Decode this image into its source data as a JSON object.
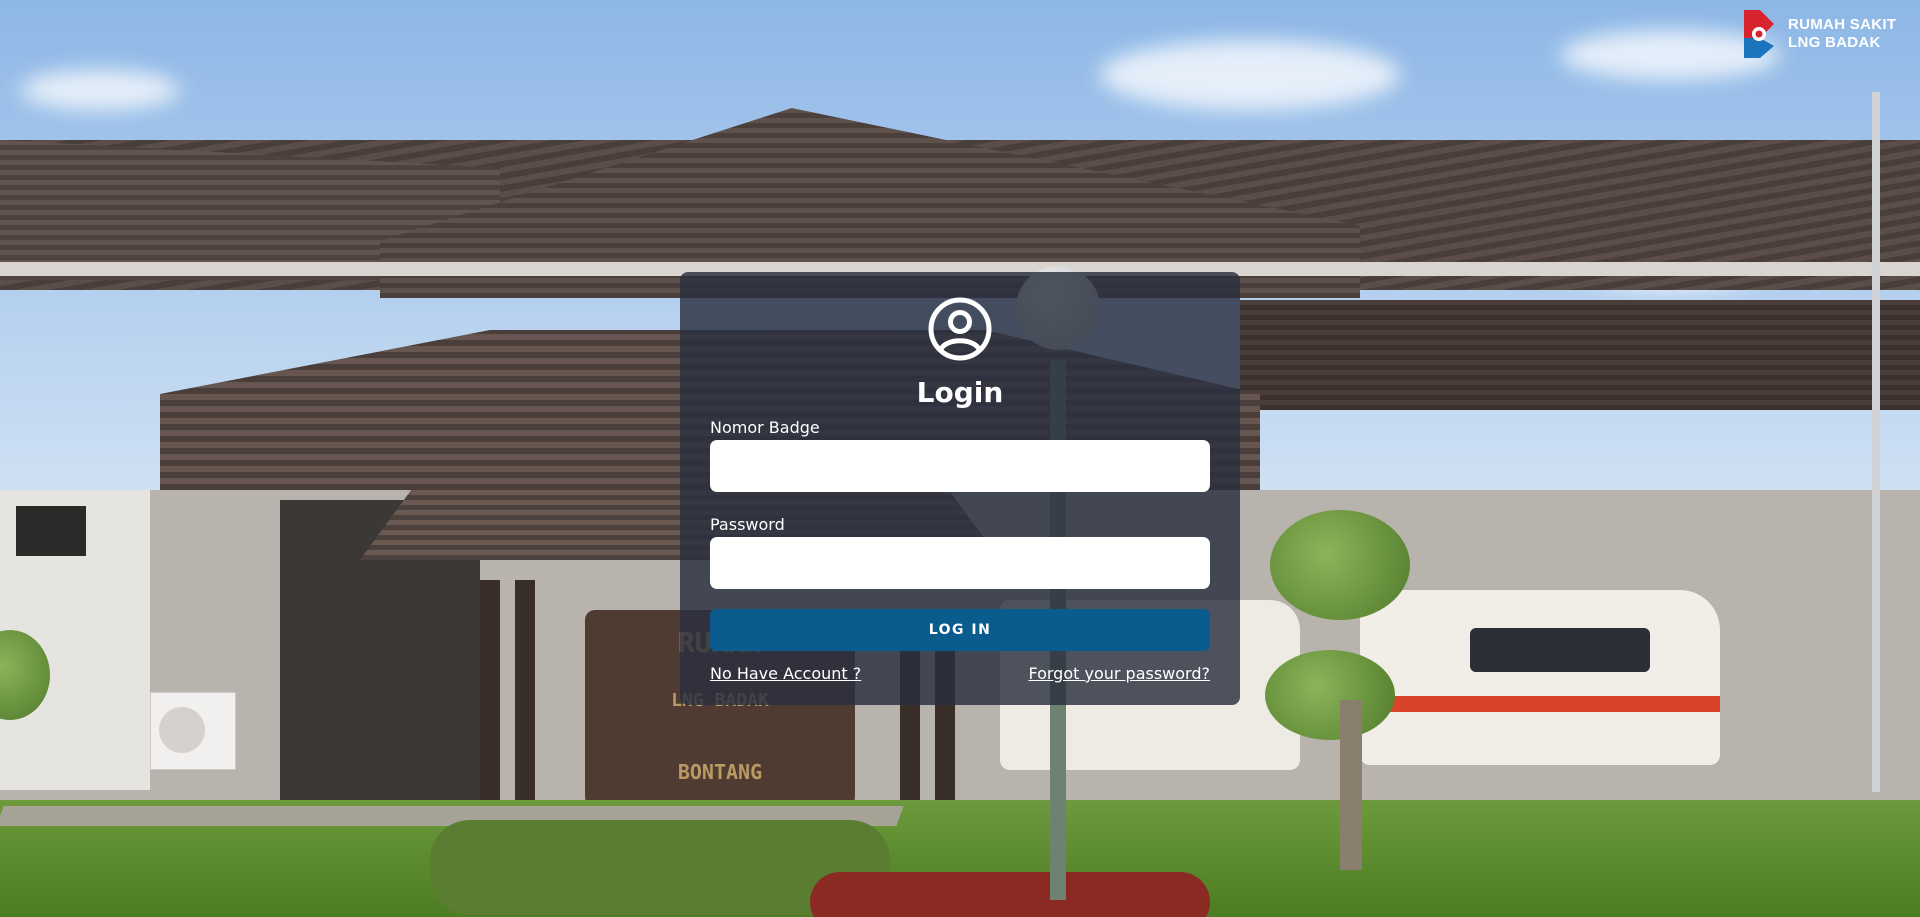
{
  "brand": {
    "line1": "RUMAH SAKIT",
    "line2": "LNG BADAK",
    "logo_colors": [
      "#d8242e",
      "#1b75bc"
    ]
  },
  "background_sign": {
    "line1": "RUMAH",
    "line2": "LNG BADAK",
    "line3": "BONTANG"
  },
  "login": {
    "title": "Login",
    "icon": "user-circle-icon",
    "badge_label": "Nomor Badge",
    "badge_value": "",
    "badge_placeholder": "",
    "password_label": "Password",
    "password_value": "",
    "password_placeholder": "",
    "submit_label": "LOG IN",
    "register_link": "No Have Account ?",
    "forgot_link": "Forgot your password?",
    "accent_color": "#0a5c8e"
  }
}
